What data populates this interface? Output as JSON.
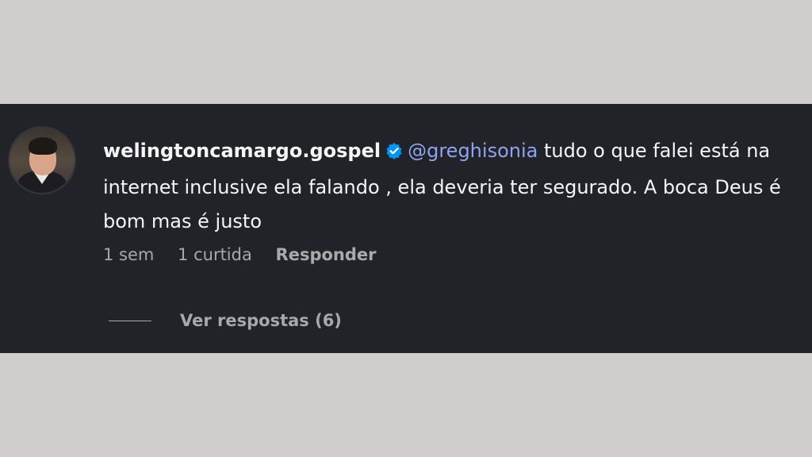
{
  "comment": {
    "username": "welingtoncamargo.gospel",
    "verified": true,
    "mention": "@greghisonia",
    "text": " tudo o que falei está na internet inclusive ela falando , ela deveria ter segurado. A boca Deus é bom mas é justo",
    "time": "1 sem",
    "likes": "1 curtida",
    "reply_label": "Responder",
    "view_replies_label": "Ver respostas (6)"
  },
  "colors": {
    "panel_bg": "#212328",
    "page_bg": "#d0cdcc",
    "mention": "#8fa3f0",
    "verified_badge": "#0095f6",
    "meta_text": "#a8a8a8"
  },
  "icons": {
    "verified": "verified-badge-icon"
  }
}
